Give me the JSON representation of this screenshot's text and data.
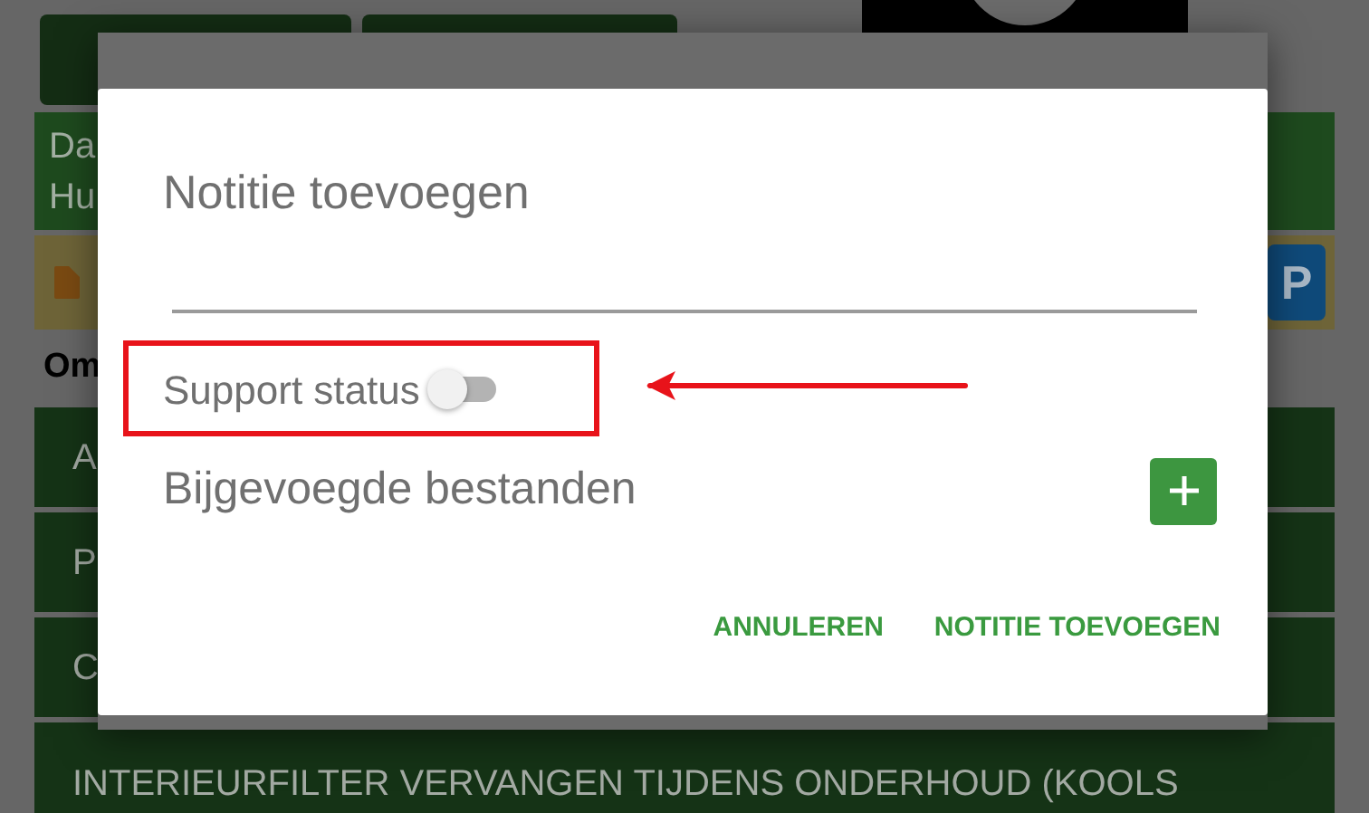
{
  "background": {
    "info_lines": [
      "Da",
      "Hu"
    ],
    "section_title": "Om",
    "badge": "P",
    "list_items": [
      "A",
      "P",
      "C",
      "INTERIEURFILTER VERVANGEN TIJDENS ONDERHOUD (KOOLS"
    ]
  },
  "dialog": {
    "title": "Notitie toevoegen",
    "support_status": {
      "label": "Support status",
      "on": false
    },
    "attachments_label": "Bijgevoegde bestanden",
    "buttons": [
      "ANNULEREN",
      "NOTITIE TOEVOEGEN"
    ]
  }
}
